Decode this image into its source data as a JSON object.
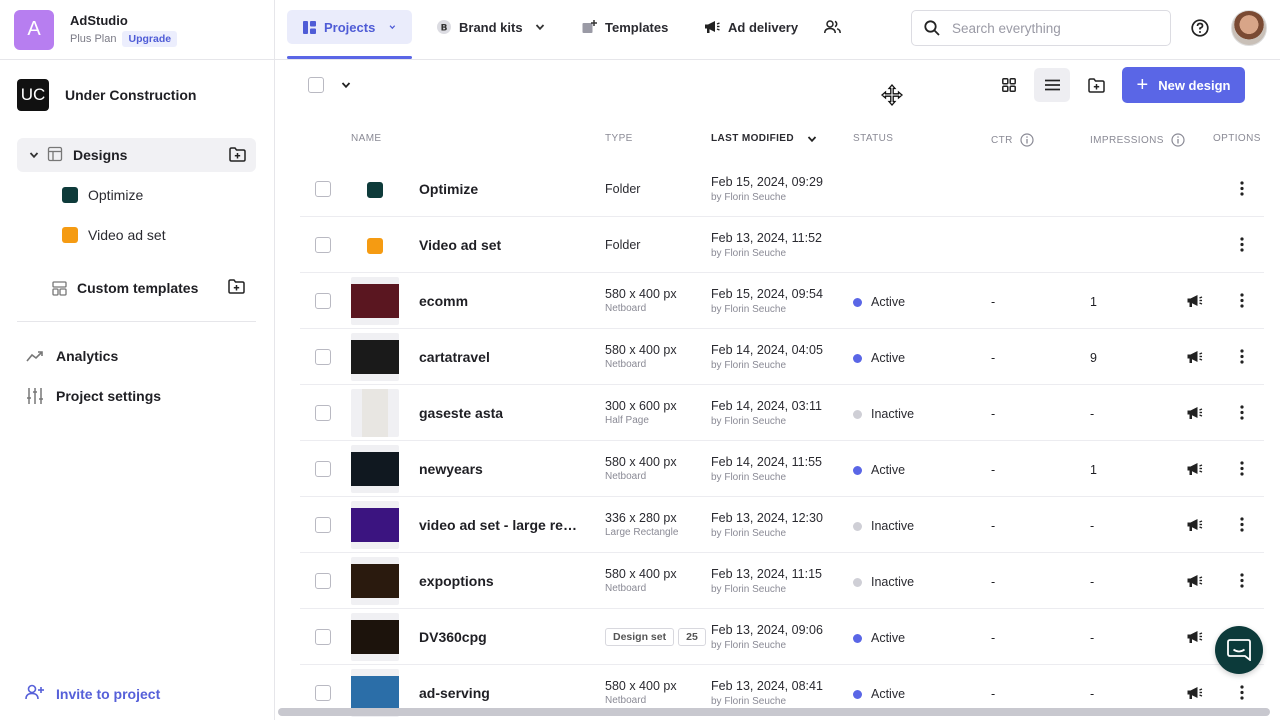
{
  "app": {
    "name": "AdStudio",
    "logo_letter": "A",
    "plan": "Plus Plan",
    "upgrade_label": "Upgrade",
    "accent": "#5a66e6"
  },
  "project": {
    "badge": "UC",
    "name": "Under Construction"
  },
  "sidebar": {
    "designs_label": "Designs",
    "folders": [
      {
        "label": "Optimize",
        "color": "#0e3b3a"
      },
      {
        "label": "Video ad set",
        "color": "#f59b12"
      }
    ],
    "custom_templates_label": "Custom templates",
    "analytics_label": "Analytics",
    "project_settings_label": "Project settings",
    "invite_label": "Invite to project"
  },
  "topnav": {
    "tabs": [
      {
        "label": "Projects",
        "icon": "grid-icon",
        "active": true
      },
      {
        "label": "Brand kits",
        "icon": "brand-b-icon"
      },
      {
        "label": "Templates",
        "icon": "template-add-icon"
      },
      {
        "label": "Ad delivery",
        "icon": "megaphone-icon"
      }
    ],
    "search_placeholder": "Search everything"
  },
  "toolbar": {
    "new_design_label": "New design"
  },
  "table": {
    "headers": {
      "name": "NAME",
      "type": "TYPE",
      "last_modified": "LAST MODIFIED",
      "status": "STATUS",
      "ctr": "CTR",
      "impressions": "IMPRESSIONS",
      "options": "OPTIONS"
    },
    "rows": [
      {
        "kind": "folder",
        "color": "#0e3b3a",
        "name": "Optimize",
        "type": "Folder",
        "modified": "Feb 15, 2024, 09:29",
        "by": "by Florin Seuche"
      },
      {
        "kind": "folder",
        "color": "#f59b12",
        "name": "Video ad set",
        "type": "Folder",
        "modified": "Feb 13, 2024, 11:52",
        "by": "by Florin Seuche"
      },
      {
        "kind": "design",
        "thumb": "#5a1620",
        "name": "ecomm",
        "type": "580 x 400 px",
        "type_sub": "Netboard",
        "modified": "Feb 15, 2024, 09:54",
        "by": "by Florin Seuche",
        "status": "Active",
        "ctr": "-",
        "impressions": "1"
      },
      {
        "kind": "design",
        "thumb": "#1a1a1a",
        "name": "cartatravel",
        "type": "580 x 400 px",
        "type_sub": "Netboard",
        "modified": "Feb 14, 2024, 04:05",
        "by": "by Florin Seuche",
        "status": "Active",
        "ctr": "-",
        "impressions": "9"
      },
      {
        "kind": "design",
        "thumb": "#e8e6e2",
        "tall": true,
        "name": "gaseste asta",
        "type": "300 x 600 px",
        "type_sub": "Half Page",
        "modified": "Feb 14, 2024, 03:11",
        "by": "by Florin Seuche",
        "status": "Inactive",
        "ctr": "-",
        "impressions": "-"
      },
      {
        "kind": "design",
        "thumb": "#101820",
        "name": "newyears",
        "type": "580 x 400 px",
        "type_sub": "Netboard",
        "modified": "Feb 14, 2024, 11:55",
        "by": "by Florin Seuche",
        "status": "Active",
        "ctr": "-",
        "impressions": "1"
      },
      {
        "kind": "design",
        "thumb": "#3b1480",
        "name": "video ad set - large rectangle",
        "type": "336 x 280 px",
        "type_sub": "Large Rectangle",
        "modified": "Feb 13, 2024, 12:30",
        "by": "by Florin Seuche",
        "status": "Inactive",
        "ctr": "-",
        "impressions": "-"
      },
      {
        "kind": "design",
        "thumb": "#2a1a0e",
        "name": "expoptions",
        "type": "580 x 400 px",
        "type_sub": "Netboard",
        "modified": "Feb 13, 2024, 11:15",
        "by": "by Florin Seuche",
        "status": "Inactive",
        "ctr": "-",
        "impressions": "-"
      },
      {
        "kind": "designset",
        "thumb": "#1c130c",
        "name": "DV360cpg",
        "set_label": "Design set",
        "set_count": "25",
        "modified": "Feb 13, 2024, 09:06",
        "by": "by Florin Seuche",
        "status": "Active",
        "ctr": "-",
        "impressions": "-"
      },
      {
        "kind": "design",
        "thumb": "#2b6ea8",
        "name": "ad-serving",
        "type": "580 x 400 px",
        "type_sub": "Netboard",
        "modified": "Feb 13, 2024, 08:41",
        "by": "by Florin Seuche",
        "status": "Active",
        "ctr": "-",
        "impressions": "-"
      }
    ]
  },
  "status_colors": {
    "Active": "#5a66e6",
    "Inactive": "#cfcfd6"
  }
}
